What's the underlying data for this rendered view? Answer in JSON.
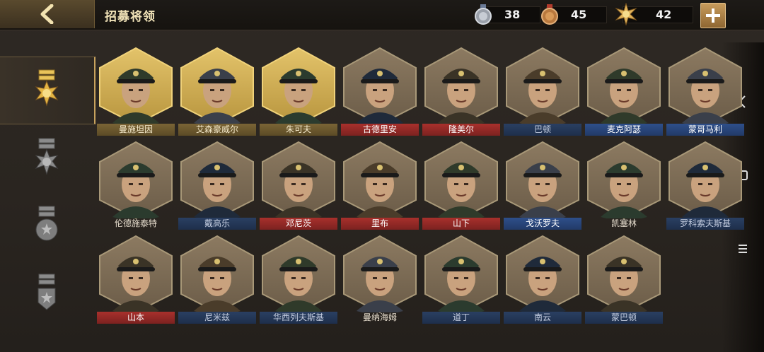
{
  "header": {
    "back_icon": "chevron-left-icon",
    "title": "招募将领",
    "resources": [
      {
        "name": "silver-medal-icon",
        "value": "38",
        "color": "#b8bcc4"
      },
      {
        "name": "bronze-medal-icon",
        "value": "45",
        "color": "#c98a4a"
      },
      {
        "name": "gold-star-medal-icon",
        "value": "42",
        "color": "#e0b25a"
      }
    ],
    "plus_icon": "plus-icon"
  },
  "tabs": [
    {
      "name": "tier-gold-tab",
      "active": true
    },
    {
      "name": "tier-silver-tab",
      "active": false
    },
    {
      "name": "tier-bronze-tab",
      "active": false
    },
    {
      "name": "tier-basic-tab",
      "active": false
    }
  ],
  "generals": [
    {
      "name": "曼施坦因",
      "tier": "gold"
    },
    {
      "name": "艾森豪威尔",
      "tier": "gold"
    },
    {
      "name": "朱可夫",
      "tier": "gold"
    },
    {
      "name": "古德里安",
      "tier": "red"
    },
    {
      "name": "隆美尔",
      "tier": "red"
    },
    {
      "name": "巴顿",
      "tier": "dblue"
    },
    {
      "name": "麦克阿瑟",
      "tier": "blue"
    },
    {
      "name": "蒙哥马利",
      "tier": "blue"
    },
    {
      "name": "伦德施泰特",
      "tier": "none"
    },
    {
      "name": "戴高乐",
      "tier": "dblue"
    },
    {
      "name": "邓尼茨",
      "tier": "red"
    },
    {
      "name": "里布",
      "tier": "red"
    },
    {
      "name": "山下",
      "tier": "red"
    },
    {
      "name": "戈沃罗夫",
      "tier": "blue"
    },
    {
      "name": "凯塞林",
      "tier": "none"
    },
    {
      "name": "罗科索夫斯基",
      "tier": "dblue"
    },
    {
      "name": "山本",
      "tier": "red"
    },
    {
      "name": "尼米兹",
      "tier": "dblue"
    },
    {
      "name": "华西列夫斯基",
      "tier": "dblue"
    },
    {
      "name": "曼纳海姆",
      "tier": "none"
    },
    {
      "name": "道丁",
      "tier": "dblue"
    },
    {
      "name": "南云",
      "tier": "dblue"
    },
    {
      "name": "蒙巴顿",
      "tier": "dblue"
    }
  ],
  "right_side": [
    "chevron-left-icon",
    "square-icon",
    "menu-icon"
  ]
}
